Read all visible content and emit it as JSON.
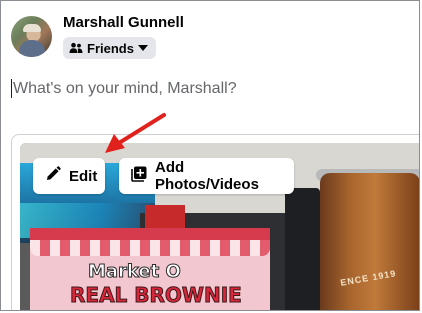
{
  "post_composer": {
    "user_name": "Marshall Gunnell",
    "audience_label": "Friends",
    "audience_icon": "friends-icon",
    "dropdown_icon": "caret-down-icon",
    "placeholder": "What's on your mind, Marshall?"
  },
  "media": {
    "edit_label": "Edit",
    "edit_icon": "pencil-icon",
    "add_label": "Add Photos/Videos",
    "add_icon": "add-photo-icon",
    "photo_text_1": "Market O",
    "photo_text_2": "REAL BROWNIE",
    "photo_text_3": "ENCE 1919"
  },
  "annotation": {
    "arrow_color": "#e0211c"
  },
  "colors": {
    "pill_bg": "#e4e6eb",
    "placeholder": "#65676b"
  }
}
